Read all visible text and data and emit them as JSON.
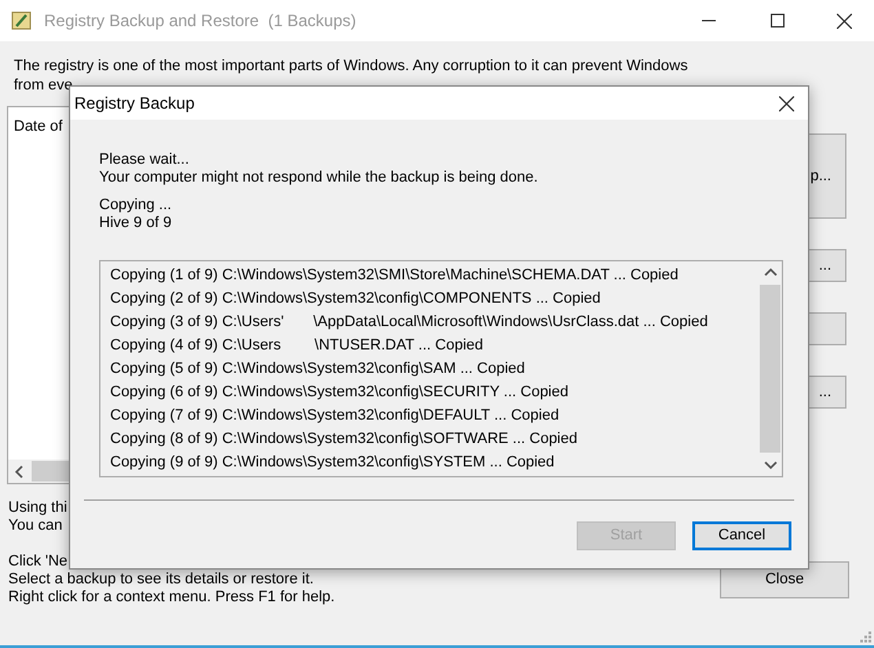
{
  "window": {
    "title": "Registry Backup and Restore  (1 Backups)"
  },
  "intro": [
    "The registry is one of the most important parts of Windows. Any corruption to it can prevent Windows",
    "from eve"
  ],
  "backups_list": {
    "column_1": "Date of"
  },
  "side_buttons": [
    {
      "kind": "text",
      "label": "p..."
    },
    {
      "kind": "text",
      "label": "..."
    },
    {
      "kind": "blank"
    },
    {
      "kind": "text",
      "label": "..."
    }
  ],
  "help_paragraphs": [
    [
      "Using thi",
      "You can"
    ],
    [
      "Click 'Ne",
      "Select a backup to see its details or restore it.",
      "Right click for a context menu. Press F1 for help."
    ]
  ],
  "close_button": "Close",
  "dialog": {
    "title": "Registry Backup",
    "message": [
      "Please wait...",
      "Your computer might not respond while the backup is being done."
    ],
    "status": [
      "Copying ...",
      "Hive 9 of 9"
    ],
    "log": [
      "Copying (1 of 9) C:\\Windows\\System32\\SMI\\Store\\Machine\\SCHEMA.DAT ... Copied",
      "Copying (2 of 9) C:\\Windows\\System32\\config\\COMPONENTS ... Copied",
      "Copying (3 of 9) C:\\Users'       \\AppData\\Local\\Microsoft\\Windows\\UsrClass.dat ... Copied",
      "Copying (4 of 9) C:\\Users        \\NTUSER.DAT ... Copied",
      "Copying (5 of 9) C:\\Windows\\System32\\config\\SAM ... Copied",
      "Copying (6 of 9) C:\\Windows\\System32\\config\\SECURITY ... Copied",
      "Copying (7 of 9) C:\\Windows\\System32\\config\\DEFAULT ... Copied",
      "Copying (8 of 9) C:\\Windows\\System32\\config\\SOFTWARE ... Copied",
      "Copying (9 of 9) C:\\Windows\\System32\\config\\SYSTEM ... Copied"
    ],
    "buttons": [
      {
        "label": "Start",
        "disabled": true,
        "default": false
      },
      {
        "label": "Cancel",
        "disabled": false,
        "default": true
      }
    ]
  }
}
